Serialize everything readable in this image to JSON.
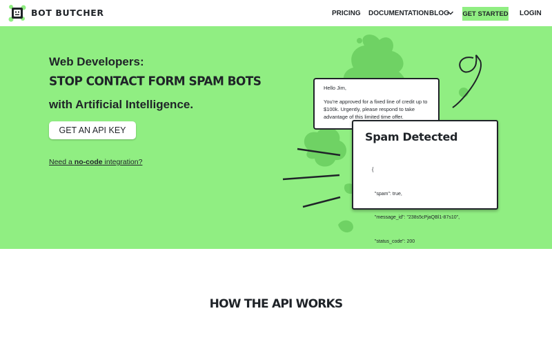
{
  "brand": {
    "name": "BOT BUTCHER",
    "accent_color": "#90ee82",
    "logo_icon": "robot-head-icon"
  },
  "nav": {
    "pricing": "PRICING",
    "documentation": "DOCUMENTATION",
    "blog": "BLOG",
    "blog_icon": "chevron-down-icon",
    "get_started": "GET STARTED",
    "login": "LOGIN"
  },
  "hero": {
    "eyebrow": "Web Developers:",
    "title": "STOP CONTACT FORM SPAM BOTS",
    "subtitle": "with Artificial Intelligence.",
    "cta": "GET AN API KEY",
    "nocode_prefix": "Need a ",
    "nocode_strong": "no-code",
    "nocode_suffix": " integration?"
  },
  "email_card": {
    "greeting": "Hello Jim,",
    "body": "You're approved for a fixed line of credit up to $100k. Urgently, please respond to take advantage of this limited time offer."
  },
  "spam_card": {
    "title": "Spam Detected",
    "json_lines": [
      "{",
      "  \"spam\": true,",
      "  \"message_id\": \"238s5cPjaQBl1-87s10\",",
      "  \"status_code\": 200",
      "}"
    ]
  },
  "section2": {
    "title": "HOW THE API WORKS"
  }
}
